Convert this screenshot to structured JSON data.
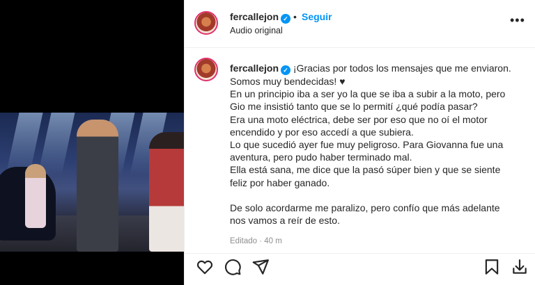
{
  "post": {
    "username": "fercallejon",
    "follow_label": "Seguir",
    "dot": "•",
    "audio_label": "Audio original",
    "more_label": "•••",
    "verified_mark": "✓"
  },
  "caption": {
    "username": "fercallejon",
    "lines": [
      "¡Gracias por todos los mensajes que me enviaron.",
      "Somos muy bendecidas! ♥",
      "En un principio iba a ser yo la que se iba a subir a la moto, pero",
      "Gio me insistió tanto que se lo permití ¿qué podía pasar?",
      "Era una moto eléctrica, debe ser por eso que no oí el motor",
      "encendido y por eso accedí a que subiera.",
      "Lo que sucedió ayer fue muy peligroso. Para Giovanna fue una",
      "aventura, pero pudo haber terminado mal.",
      "Ella está sana, me dice que la pasó súper bien y que se siente",
      "feliz por haber ganado.",
      "",
      "De solo acordarme me paralizo, pero confío que más adelante",
      "nos vamos a reír de esto."
    ],
    "edited": "Editado · 40 m"
  },
  "actions": {
    "icons": [
      "heart-icon",
      "comment-icon",
      "share-icon",
      "save-icon",
      "download-icon"
    ]
  },
  "colors": {
    "accent": "#0095f6",
    "text": "#262626",
    "muted": "#8e8e8e",
    "media_bg": "#000000"
  }
}
